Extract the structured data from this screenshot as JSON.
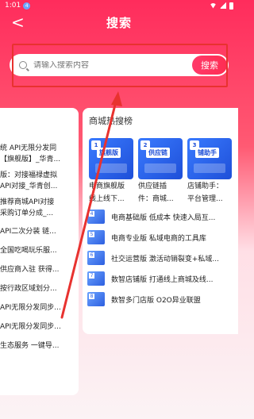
{
  "status": {
    "time": "1:01",
    "notif": "4"
  },
  "header": {
    "back": "<",
    "title": "搜索"
  },
  "search": {
    "placeholder": "请输入搜索内容",
    "button": "搜索"
  },
  "left_list": [
    {
      "l1": "统 API无限分发同",
      "l2": "【旗舰版】_华青..."
    },
    {
      "l1": "版：对接福禄虚拟",
      "l2": "API对接_华青创..."
    },
    {
      "l1": "推荐商城API对接",
      "l2": "采购订单分成_..."
    },
    {
      "l1": "API二次分装 链..."
    },
    {
      "l1": "全国吃喝玩乐服..."
    },
    {
      "l1": "供应商入驻 获得..."
    },
    {
      "l1": "按行政区域划分..."
    },
    {
      "l1": "API无限分发同步..."
    },
    {
      "l1": "API无限分发同步..."
    },
    {
      "l1": "生态服务 一键导..."
    }
  ],
  "right": {
    "title": "商城热搜榜",
    "features": [
      {
        "rank": "1",
        "tag": "旗舰版",
        "c1": "电商旗舰版",
        "c2": "线上线下..."
      },
      {
        "rank": "2",
        "tag": "供应链",
        "c1": "供应链插",
        "c2": "件：商城..."
      },
      {
        "rank": "3",
        "tag": "铺助手",
        "c1": "店铺助手：",
        "c2": "平台管理..."
      }
    ],
    "list": [
      {
        "rank": "4",
        "text": "电商基础版 低成本 快速入局互..."
      },
      {
        "rank": "5",
        "text": "电商专业版 私域电商的工具库"
      },
      {
        "rank": "6",
        "text": "社交运营版 激活动销裂变+私域..."
      },
      {
        "rank": "7",
        "text": "数智店铺版 打通线上商城及线..."
      },
      {
        "rank": "8",
        "text": "数智多门店版 O2O异业联盟"
      }
    ]
  },
  "colors": {
    "accent": "#ff2c5c",
    "annotation": "#e8322f"
  }
}
